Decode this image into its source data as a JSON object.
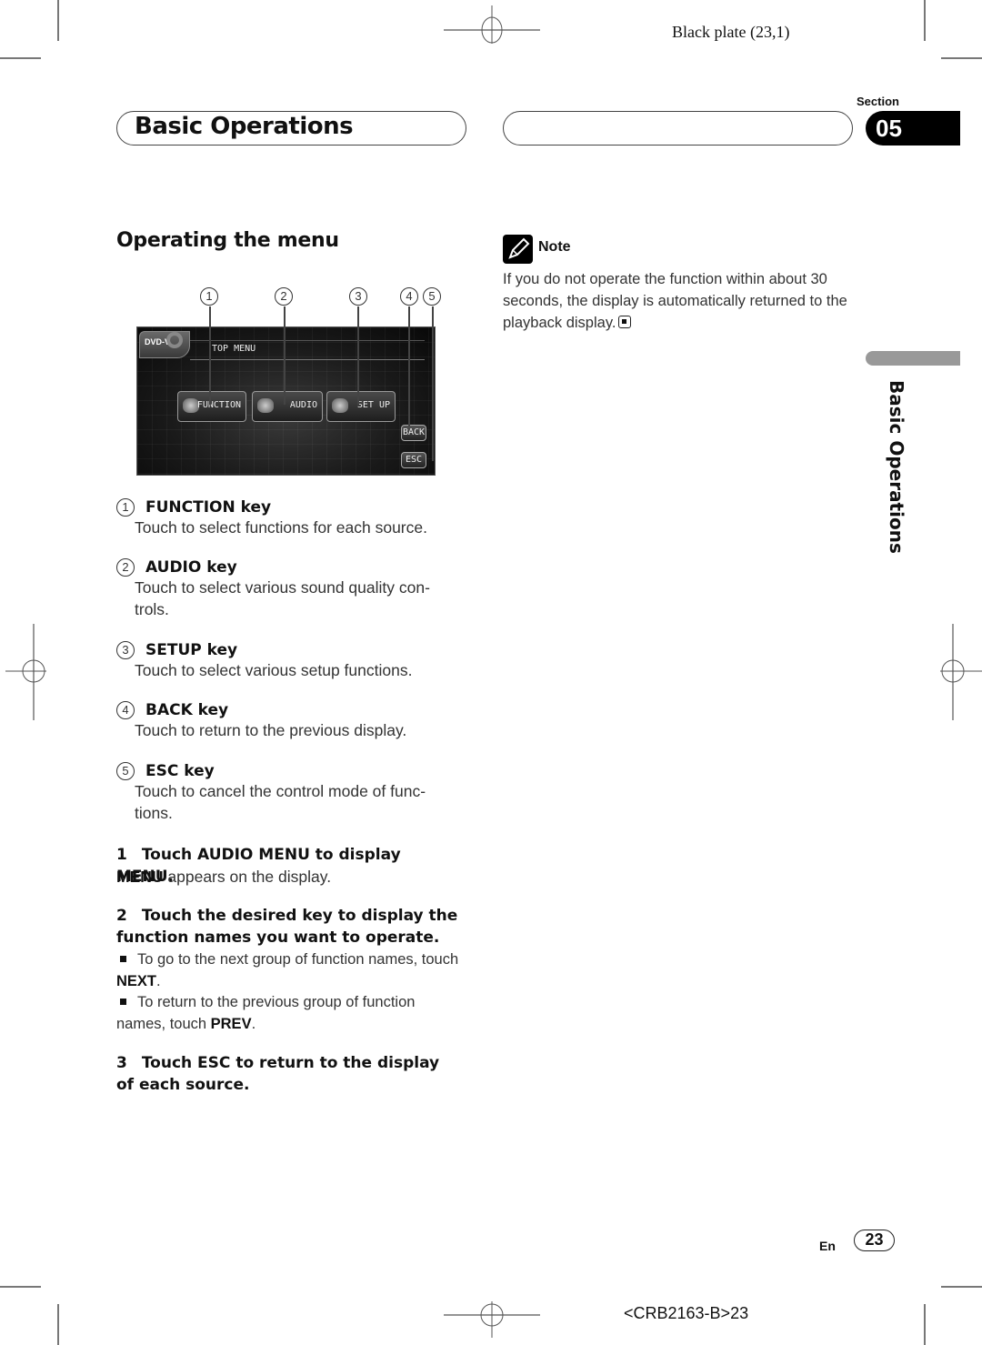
{
  "print_marks": {
    "plate_label": "Black plate (23,1)",
    "job_code": "<CRB2163-B>23"
  },
  "header": {
    "title": "Basic Operations",
    "section_label": "Section",
    "section_number": "05"
  },
  "main": {
    "heading": "Operating the menu",
    "screenshot": {
      "callouts": [
        "1",
        "2",
        "3",
        "4",
        "5"
      ],
      "source_tab": "DVD-V",
      "screen_title": "TOP MENU",
      "keys": {
        "function": "FUNCTION",
        "audio": "AUDIO",
        "setup": "SET UP",
        "back": "BACK",
        "esc": "ESC"
      }
    },
    "items": [
      {
        "num": "1",
        "title": "FUNCTION key",
        "desc": "Touch to select functions for each source."
      },
      {
        "num": "2",
        "title": "AUDIO key",
        "desc": "Touch to select various sound quality con- trols."
      },
      {
        "num": "3",
        "title": "SETUP key",
        "desc": "Touch to select various setup functions."
      },
      {
        "num": "4",
        "title": "BACK key",
        "desc": "Touch to return to the previous display."
      },
      {
        "num": "5",
        "title": "ESC key",
        "desc": "Touch to cancel the control mode of func- tions."
      }
    ],
    "steps": [
      {
        "num": "1",
        "title": "Touch AUDIO MENU to display MENU.",
        "body_bold": "MENU",
        "body_rest": " appears on the display."
      },
      {
        "num": "2",
        "title": "Touch the desired key to display the function names you want to operate.",
        "bullets": [
          {
            "text": "To go to the next group of function names, touch ",
            "bold": "NEXT",
            "end": "."
          },
          {
            "text": "To return to the previous group of function names, touch ",
            "bold": "PREV",
            "end": "."
          }
        ]
      },
      {
        "num": "3",
        "title": "Touch ESC to return to the display of each source."
      }
    ]
  },
  "note": {
    "label": "Note",
    "text": "If you do not operate the function within about 30 seconds, the display is automatically returned to the playback display."
  },
  "side_tab": {
    "label": "Basic Operations"
  },
  "footer": {
    "lang": "En",
    "page": "23"
  }
}
